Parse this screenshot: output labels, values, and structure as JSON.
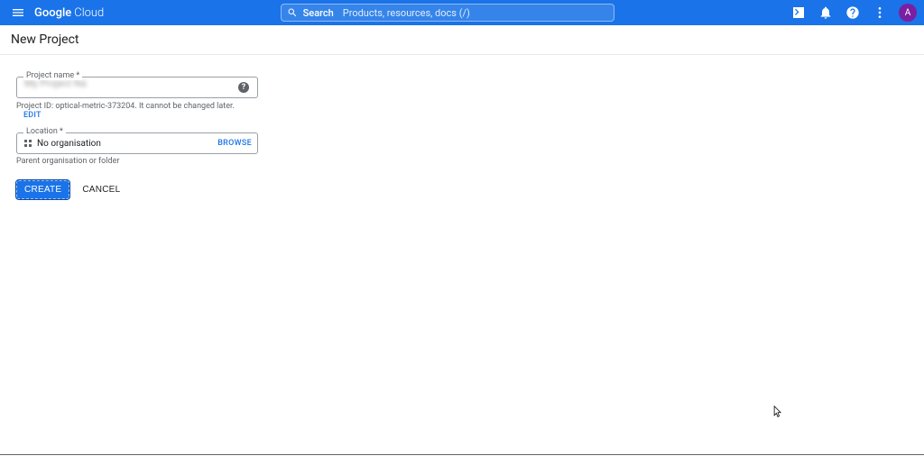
{
  "topbar": {
    "logo_bold": "Google",
    "logo_light": "Cloud",
    "search_label": "Search",
    "search_placeholder": "Products, resources, docs (/)",
    "avatar_letter": "A"
  },
  "page": {
    "title": "New Project"
  },
  "form": {
    "project_name_label": "Project name *",
    "project_name_value": "My Project Na",
    "project_id_prefix": "Project ID:",
    "project_id_value": "optical-metric-373204",
    "project_id_suffix": ". It cannot be changed later.",
    "edit_label": "EDIT",
    "location_label": "Location *",
    "location_value": "No organisation",
    "browse_label": "BROWSE",
    "location_helper": "Parent organisation or folder",
    "create_label": "CREATE",
    "cancel_label": "CANCEL"
  },
  "colors": {
    "primary": "#1a73e8",
    "avatar": "#7b1fa2"
  }
}
